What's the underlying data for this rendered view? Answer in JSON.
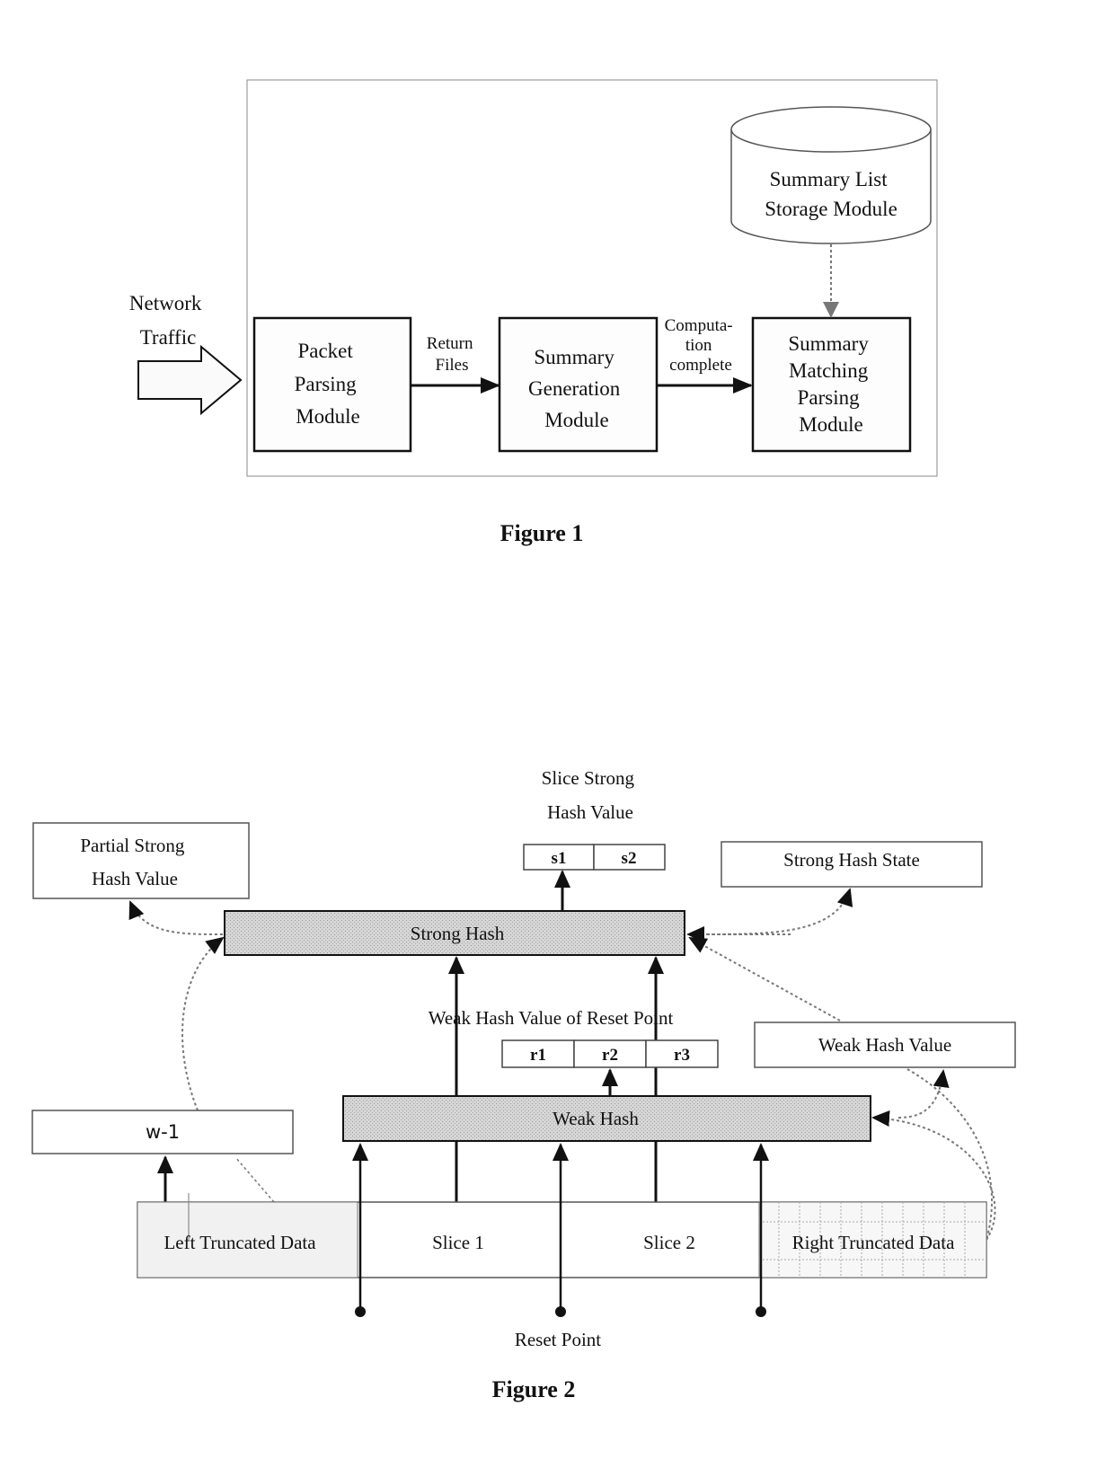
{
  "figure1": {
    "caption": "Figure 1",
    "input_label": [
      "Network",
      "Traffic"
    ],
    "modules": {
      "packet_parsing": [
        "Packet",
        "Parsing",
        "Module"
      ],
      "summary_generation": [
        "Summary",
        "Generation",
        "Module"
      ],
      "summary_matching": [
        "Summary",
        "Matching",
        "Parsing",
        "Module"
      ],
      "storage": [
        "Summary List",
        "Storage Module"
      ]
    },
    "edges": {
      "return_files": [
        "Return",
        "Files"
      ],
      "computation_complete": [
        "Computa-",
        "tion",
        "complete"
      ]
    }
  },
  "figure2": {
    "caption": "Figure 2",
    "slice_strong_hash_value": [
      "Slice Strong",
      "Hash Value"
    ],
    "partial_strong_hash_value": [
      "Partial Strong",
      "Hash Value"
    ],
    "strong_hash_state": "Strong Hash State",
    "strong_hash": "Strong Hash",
    "weak_hash": "Weak Hash",
    "weak_hash_value_reset_point": "Weak Hash Value of Reset Point",
    "weak_hash_value": "Weak Hash Value",
    "w_minus_1": "w-1",
    "s_cells": [
      "s1",
      "s2"
    ],
    "r_cells": [
      "r1",
      "r2",
      "r3"
    ],
    "data_segments": {
      "left": "Left Truncated Data",
      "slice1": "Slice 1",
      "slice2": "Slice 2",
      "right": "Right Truncated Data"
    },
    "reset_point": "Reset Point"
  }
}
